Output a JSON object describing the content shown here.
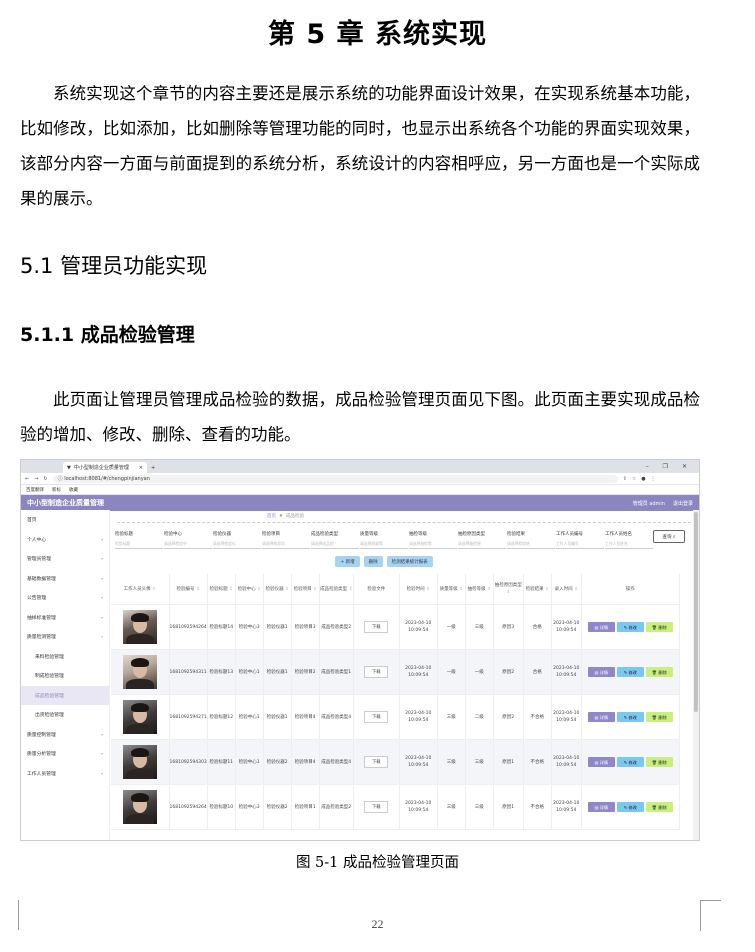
{
  "doc": {
    "chapter_title": "第 5 章  系统实现",
    "intro": "系统实现这个章节的内容主要还是展示系统的功能界面设计效果，在实现系统基本功能，比如修改，比如添加，比如删除等管理功能的同时，也显示出系统各个功能的界面实现效果，该部分内容一方面与前面提到的系统分析，系统设计的内容相呼应，另一方面也是一个实际成果的展示。",
    "section_title": "5.1 管理员功能实现",
    "subsection_title": "5.1.1  成品检验管理",
    "body": "此页面让管理员管理成品检验的数据，成品检验管理页面见下图。此页面主要实现成品检验的增加、修改、删除、查看的功能。",
    "caption": "图 5-1  成品检验管理页面",
    "page_number": "22"
  },
  "screenshot": {
    "browser": {
      "tab_title": "中小型制造企业质量管理",
      "url": "localhost:8081/#/chengpinjianyan",
      "bookmarks": [
        "百度翻译",
        "新标",
        "收藏"
      ],
      "new_tab": "+"
    },
    "app": {
      "title": "中小型制造企业质量管理",
      "user": "管理员 admin",
      "logout": "退出登录"
    },
    "sidebar": [
      {
        "label": "首页",
        "sub": false,
        "active": false,
        "arrow": false
      },
      {
        "label": "个人中心",
        "sub": false,
        "active": false,
        "arrow": true
      },
      {
        "label": "管理员管理",
        "sub": false,
        "active": false,
        "arrow": true
      },
      {
        "label": "基础数据管理",
        "sub": false,
        "active": false,
        "arrow": true
      },
      {
        "label": "公告管理",
        "sub": false,
        "active": false,
        "arrow": true
      },
      {
        "label": "抽样标准管理",
        "sub": false,
        "active": false,
        "arrow": true
      },
      {
        "label": "质量检测管理",
        "sub": false,
        "active": false,
        "arrow": true
      },
      {
        "label": "来料检验管理",
        "sub": true,
        "active": false,
        "arrow": false
      },
      {
        "label": "制成检验管理",
        "sub": true,
        "active": false,
        "arrow": false
      },
      {
        "label": "成品检验管理",
        "sub": true,
        "active": true,
        "arrow": false
      },
      {
        "label": "出货检验管理",
        "sub": true,
        "active": false,
        "arrow": false
      },
      {
        "label": "质量控制管理",
        "sub": false,
        "active": false,
        "arrow": true
      },
      {
        "label": "质量分析管理",
        "sub": false,
        "active": false,
        "arrow": true
      },
      {
        "label": "工作人员管理",
        "sub": false,
        "active": false,
        "arrow": true
      }
    ],
    "breadcrumb": {
      "home": "首页",
      "current": "成品检验"
    },
    "filters": [
      {
        "label": "检验标题",
        "placeholder": "检验标题"
      },
      {
        "label": "检验中心",
        "placeholder": "请选择检验中"
      },
      {
        "label": "检验仪器",
        "placeholder": "请选择检验仪"
      },
      {
        "label": "检验项目",
        "placeholder": "请选择检验项"
      },
      {
        "label": "成品检验类型",
        "placeholder": "请选择成品检"
      },
      {
        "label": "质量等级",
        "placeholder": "请选择质量等"
      },
      {
        "label": "抽检等级",
        "placeholder": "请选择抽检等"
      },
      {
        "label": "抽检原因类型",
        "placeholder": "请选择抽检原"
      },
      {
        "label": "检验结果",
        "placeholder": "请选择检验结"
      },
      {
        "label": "工作人员编号",
        "placeholder": "工作人员编号"
      },
      {
        "label": "工作人员姓名",
        "placeholder": "工作人员姓名"
      }
    ],
    "query_button": "查询",
    "action_buttons": [
      "+ 新增",
      "删除",
      "检测结果统计报表"
    ],
    "columns": [
      "工作人员头像",
      "检验编号",
      "检验标题",
      "检验中心",
      "检验仪器",
      "检验项目",
      "成品检验类型",
      "检验文件",
      "检验时间",
      "质量等级",
      "抽检等级",
      "抽检原因类型",
      "检验结果",
      "录入时间",
      "操作"
    ],
    "rows": [
      {
        "no": "1681092594264",
        "title": "检验标题14",
        "center": "检验中心3",
        "instrument": "检验仪器1",
        "item": "检验项目3",
        "type": "成品检验类型2",
        "file": "下载",
        "time": "2023-04-10 10:09:54",
        "quality": "一级",
        "sampling": "三级",
        "reason": "原因3",
        "result": "合格",
        "entry": "2023-04-10 10:09:54"
      },
      {
        "no": "1681092594311",
        "title": "检验标题13",
        "center": "检验中心1",
        "instrument": "检验仪器1",
        "item": "检验项目2",
        "type": "成品检验类型1",
        "file": "下载",
        "time": "2023-04-10 10:09:54",
        "quality": "一级",
        "sampling": "一级",
        "reason": "原因2",
        "result": "合格",
        "entry": "2023-04-10 10:09:54"
      },
      {
        "no": "1681092594271",
        "title": "检验标题12",
        "center": "检验中心1",
        "instrument": "检验仪器1",
        "item": "检验项目4",
        "type": "成品检验类型4",
        "file": "下载",
        "time": "2023-04-10 10:09:54",
        "quality": "三级",
        "sampling": "二级",
        "reason": "原因2",
        "result": "不合格",
        "entry": "2023-04-10 10:09:54"
      },
      {
        "no": "1681092594303",
        "title": "检验标题11",
        "center": "检验中心1",
        "instrument": "检验仪器2",
        "item": "检验项目4",
        "type": "成品检验类型4",
        "file": "下载",
        "time": "2023-04-10 10:09:54",
        "quality": "三级",
        "sampling": "三级",
        "reason": "原因1",
        "result": "不合格",
        "entry": "2023-04-10 10:09:54"
      },
      {
        "no": "1681092594264",
        "title": "检验标题10",
        "center": "检验中心3",
        "instrument": "检验仪器2",
        "item": "检验项目1",
        "type": "成品检验类型2",
        "file": "下载",
        "time": "2023-04-10 10:09:54",
        "quality": "三级",
        "sampling": "三级",
        "reason": "原因1",
        "result": "不合格",
        "entry": "2023-04-10 10:09:54"
      }
    ],
    "op_labels": {
      "view": "详情",
      "edit": "修改",
      "delete": "删除"
    }
  }
}
